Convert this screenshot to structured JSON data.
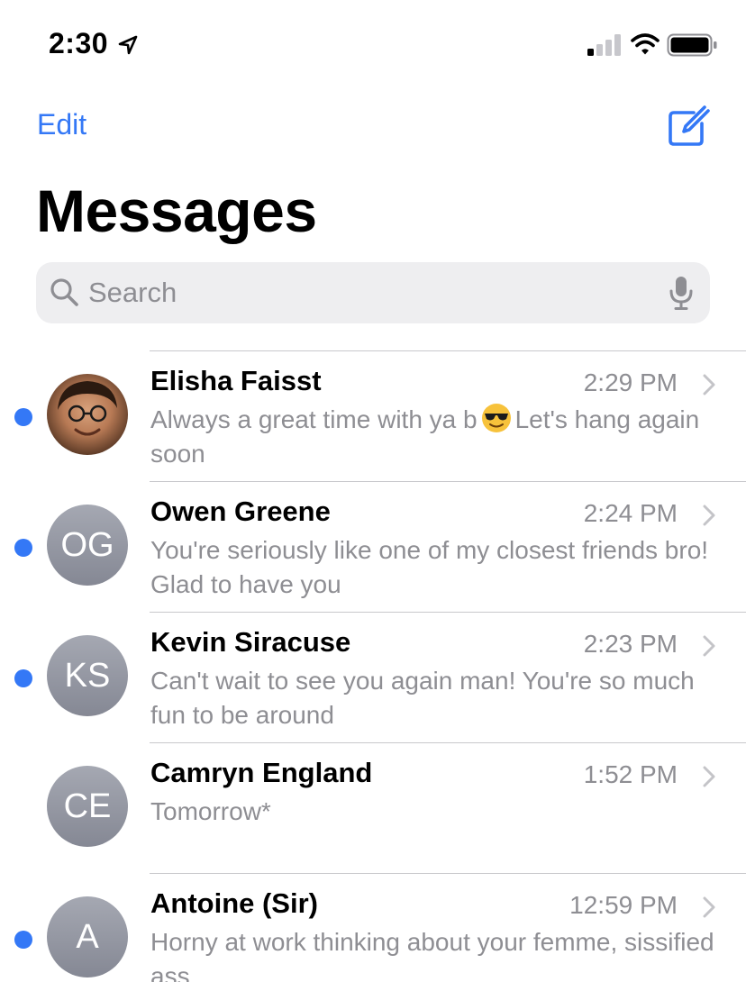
{
  "status_bar": {
    "time": "2:30",
    "location_icon": "location-arrow-icon",
    "signal_icon": "cellular-signal-icon",
    "wifi_icon": "wifi-icon",
    "battery_icon": "battery-icon"
  },
  "nav": {
    "edit_label": "Edit",
    "compose_icon": "compose-icon",
    "title": "Messages"
  },
  "search": {
    "placeholder": "Search",
    "search_icon": "search-icon",
    "mic_icon": "microphone-icon"
  },
  "colors": {
    "accent": "#3478f6",
    "unread_dot": "#3478f6",
    "secondary_text": "#8e8e93",
    "search_bg": "#eeeef0",
    "separator": "#c8c8cc"
  },
  "conversations": [
    {
      "name": "Elisha Faisst",
      "time": "2:29 PM",
      "preview_before": "Always a great time with ya b",
      "preview_emoji": "smiling-face-with-sunglasses-emoji",
      "preview_after": "Let's hang again soon",
      "unread": true,
      "avatar_type": "photo"
    },
    {
      "name": "Owen Greene",
      "time": "2:24 PM",
      "preview": "You're seriously like one of my closest friends bro! Glad to have you",
      "unread": true,
      "initials": "OG"
    },
    {
      "name": "Kevin Siracuse",
      "time": "2:23 PM",
      "preview": "Can't wait to see you again man! You're so much fun to be around",
      "unread": true,
      "initials": "KS"
    },
    {
      "name": "Camryn England",
      "time": "1:52 PM",
      "preview": "Tomorrow*",
      "unread": false,
      "initials": "CE"
    },
    {
      "name": "Antoine (Sir)",
      "time": "12:59 PM",
      "preview": "Horny at work thinking about your femme, sissified ass",
      "unread": true,
      "initials": "A"
    }
  ]
}
